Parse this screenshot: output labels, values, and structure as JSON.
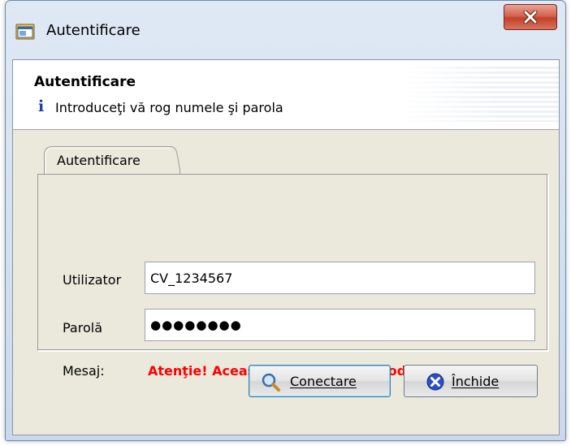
{
  "window": {
    "title": "Autentificare"
  },
  "header": {
    "title": "Autentificare",
    "subtitle": "Introduceţi vă rog numele şi parola",
    "info_glyph": "i"
  },
  "tab": {
    "label": "Autentificare"
  },
  "form": {
    "user_label": "Utilizator",
    "user_value": "CV_1234567",
    "password_label": "Parolă",
    "password_dots": "●●●●●●●●",
    "message_label": "Mesaj:",
    "message_text": "Atenţie! Aceasta este baza de producţie!"
  },
  "buttons": {
    "connect_label": "Conectare",
    "close_label": "Închide"
  },
  "icons": {
    "app": "app-window-icon",
    "close": "close-icon",
    "info": "info-icon",
    "connect": "magnifier-icon",
    "cancel": "close-circle-icon"
  },
  "colors": {
    "warning": "#ff0000",
    "info": "#1f3f9e",
    "close_button": "#c2412a"
  }
}
